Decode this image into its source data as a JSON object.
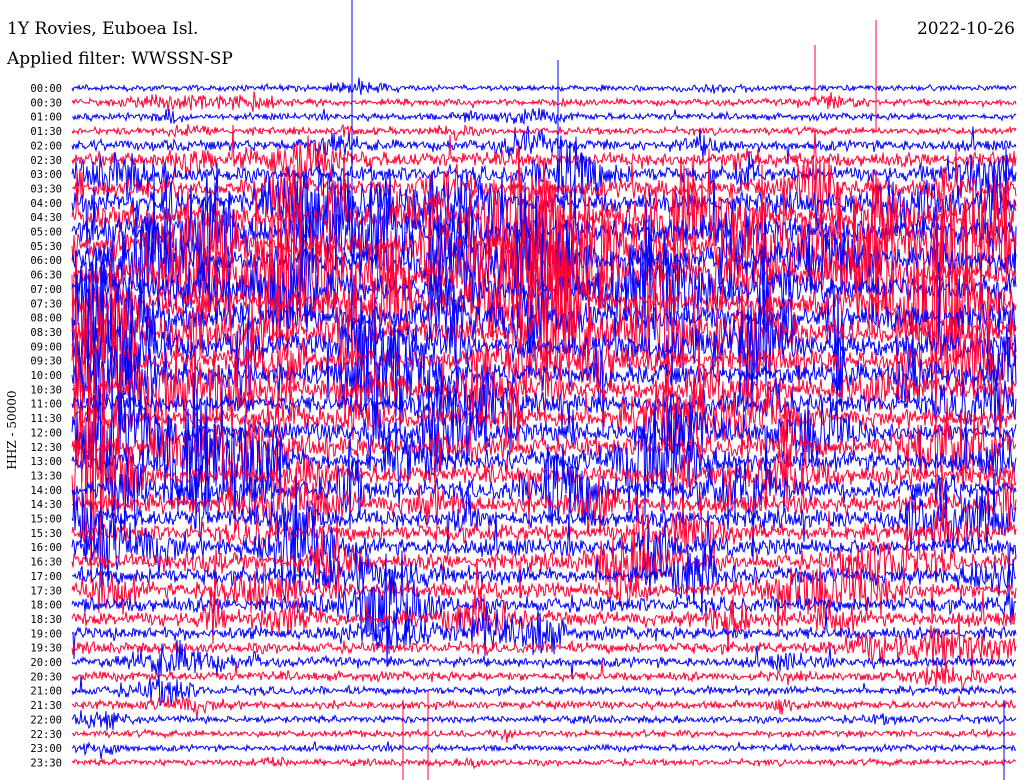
{
  "header": {
    "station": "1Y Rovies, Euboea Isl.",
    "filter": "Applied filter: WWSSN-SP",
    "date": "2022-10-26"
  },
  "chart_data": {
    "type": "line",
    "title": "1Y Rovies, Euboea Isl.",
    "subtitle": "Applied filter: WWSSN-SP",
    "ylabel": "HHZ - 50000",
    "xlabel": "",
    "row_labels": [
      "00:00",
      "00:30",
      "01:00",
      "01:30",
      "02:00",
      "02:30",
      "03:00",
      "03:30",
      "04:00",
      "04:30",
      "05:00",
      "05:30",
      "06:00",
      "06:30",
      "07:00",
      "07:30",
      "08:00",
      "08:30",
      "09:00",
      "09:30",
      "10:00",
      "10:30",
      "11:00",
      "11:30",
      "12:00",
      "12:30",
      "13:00",
      "13:30",
      "14:00",
      "14:30",
      "15:00",
      "15:30",
      "16:00",
      "16:30",
      "17:00",
      "17:30",
      "18:00",
      "18:30",
      "19:00",
      "19:30",
      "20:00",
      "20:30",
      "21:00",
      "21:30",
      "22:00",
      "22:30",
      "23:00",
      "23:30"
    ],
    "amplitude_level": [
      0.25,
      0.35,
      0.35,
      0.4,
      0.8,
      1.2,
      1.3,
      1.6,
      1.9,
      2.3,
      2.5,
      2.6,
      2.6,
      2.6,
      2.6,
      2.6,
      2.5,
      2.3,
      2.2,
      2.1,
      2.0,
      1.9,
      1.8,
      1.8,
      1.8,
      1.8,
      1.8,
      1.7,
      1.7,
      1.6,
      1.6,
      1.5,
      1.5,
      1.4,
      1.4,
      1.3,
      1.3,
      1.2,
      1.0,
      0.8,
      0.7,
      0.6,
      0.5,
      0.45,
      0.4,
      0.35,
      0.3,
      0.3
    ],
    "colors": [
      "#0000ff",
      "#ff0033"
    ],
    "grid": false
  }
}
